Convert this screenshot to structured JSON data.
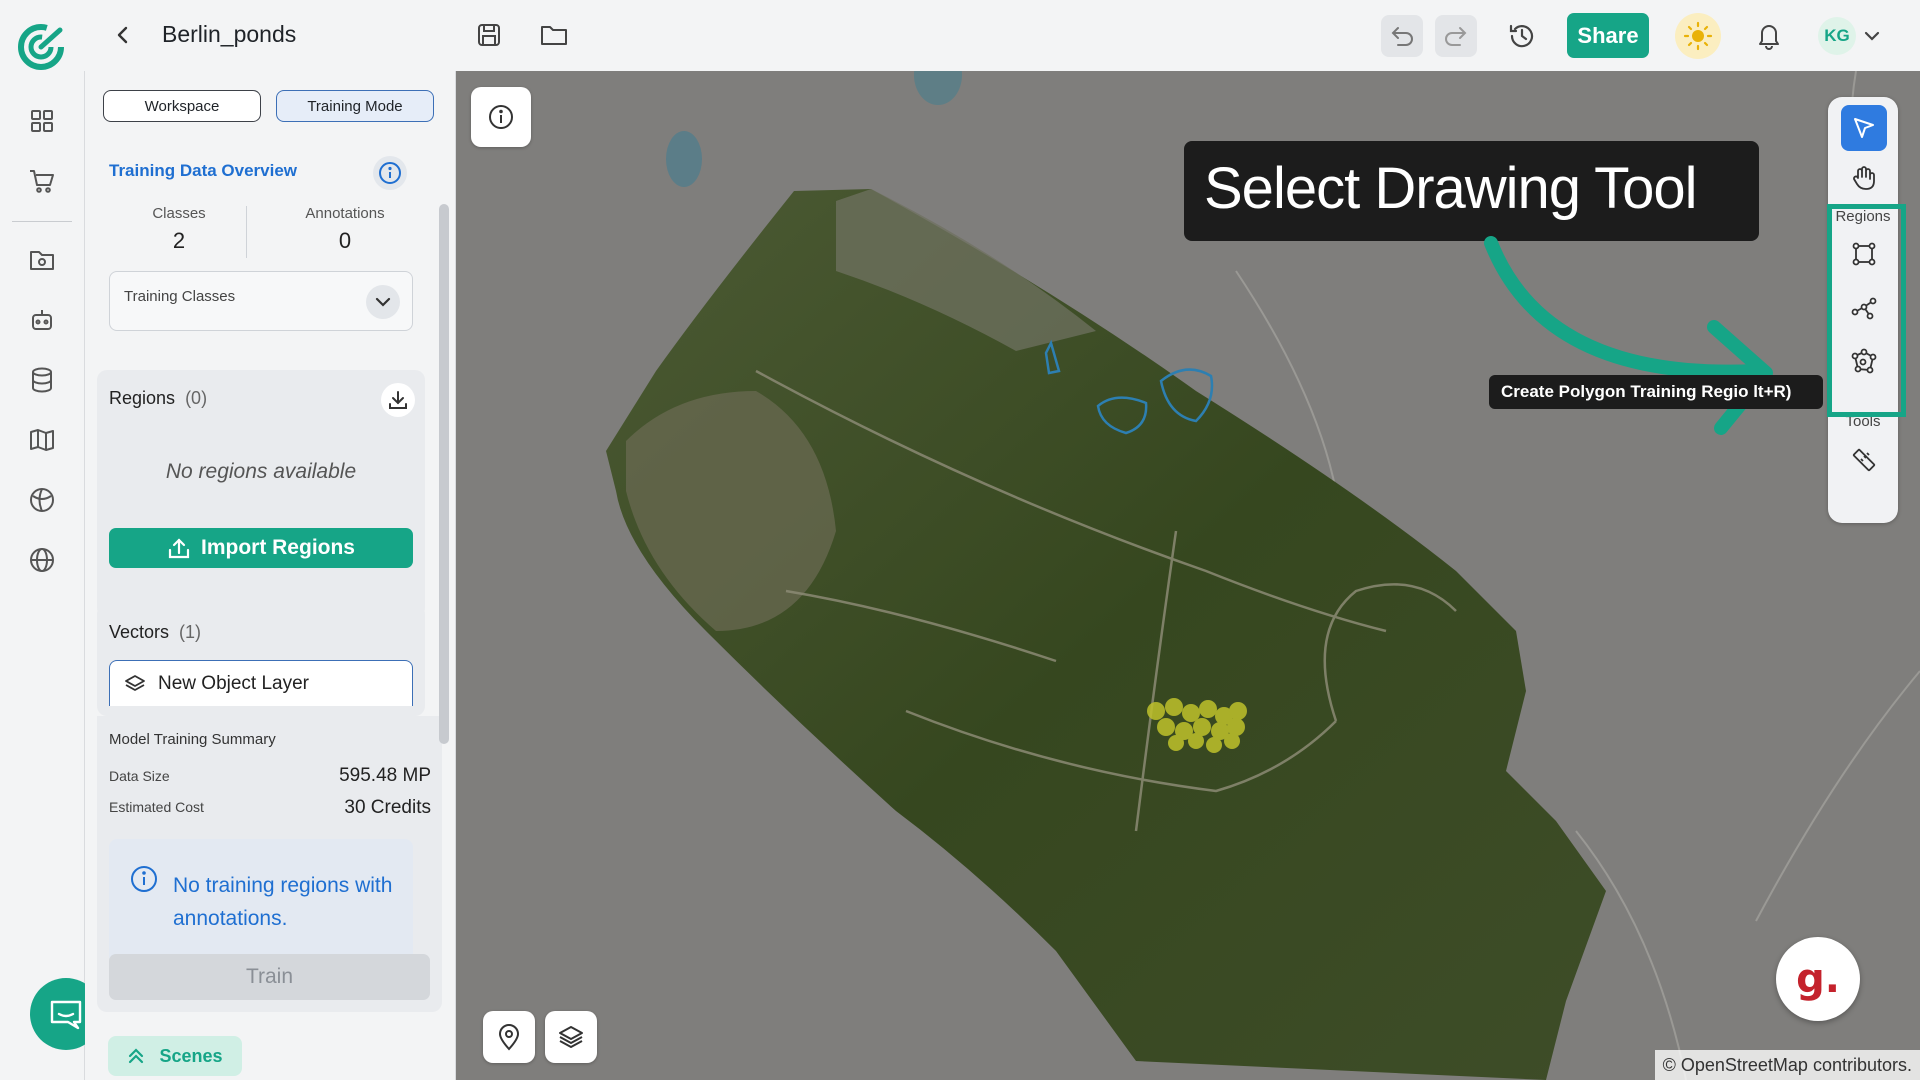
{
  "header": {
    "project_title": "Berlin_ponds",
    "share_label": "Share",
    "user_initials": "KG"
  },
  "modes": {
    "workspace_label": "Workspace",
    "training_label": "Training Mode"
  },
  "overview": {
    "title": "Training Data Overview",
    "classes_label": "Classes",
    "classes_value": "2",
    "annotations_label": "Annotations",
    "annotations_value": "0",
    "training_classes_label": "Training Classes"
  },
  "regions": {
    "title": "Regions",
    "count": "(0)",
    "empty_message": "No regions available",
    "import_label": "Import Regions"
  },
  "vectors": {
    "title": "Vectors",
    "count": "(1)",
    "layer_name": "New Object Layer"
  },
  "summary": {
    "title": "Model Training Summary",
    "data_size_label": "Data Size",
    "data_size_value": "595.48 MP",
    "cost_label": "Estimated Cost",
    "cost_value": "30 Credits",
    "notice": "No training regions with annotations.",
    "train_label": "Train"
  },
  "scenes_label": "Scenes",
  "map": {
    "callout": "Select Drawing Tool",
    "tooltip": "Create Polygon Training Regio   lt+R)",
    "regions_section": "Regions",
    "tools_section": "Tools",
    "credit": "© OpenStreetMap contributors.",
    "grain_logo": "g."
  },
  "colors": {
    "brand": "#16a587",
    "link_blue": "#1f6fd1",
    "active_tool": "#2f7be0"
  }
}
